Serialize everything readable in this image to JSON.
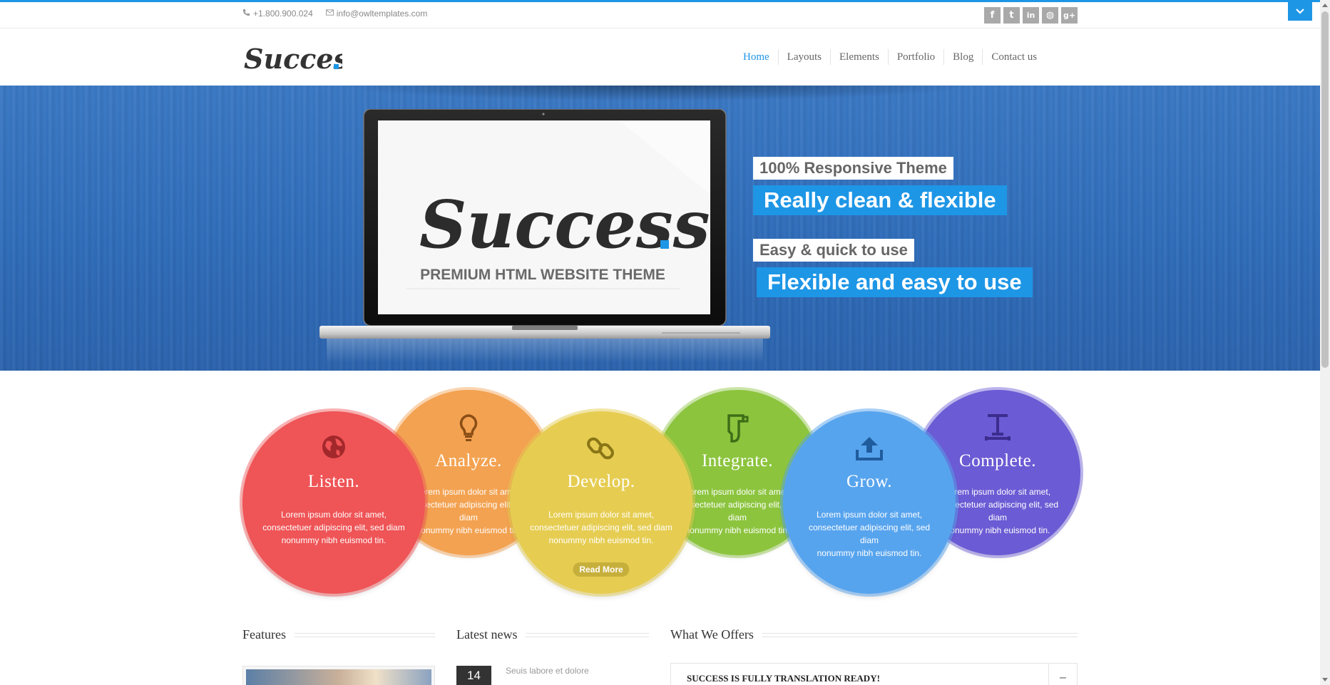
{
  "topbar": {
    "phone": "+1.800.900.024",
    "email": "info@owltemplates.com",
    "socials": [
      {
        "icon": "facebook-icon",
        "glyph": "f"
      },
      {
        "icon": "twitter-icon",
        "glyph": "t"
      },
      {
        "icon": "linkedin-icon",
        "glyph": "in"
      },
      {
        "icon": "dribbble-icon",
        "glyph": "◍"
      },
      {
        "icon": "googleplus-icon",
        "glyph": "g+"
      }
    ],
    "accent_color": "#1e96e6"
  },
  "header": {
    "logo_text": "Success",
    "nav": [
      {
        "label": "Home",
        "active": true
      },
      {
        "label": "Layouts",
        "active": false
      },
      {
        "label": "Elements",
        "active": false
      },
      {
        "label": "Portfolio",
        "active": false
      },
      {
        "label": "Blog",
        "active": false
      },
      {
        "label": "Contact us",
        "active": false
      }
    ]
  },
  "hero": {
    "screen_logo": "Success",
    "screen_tagline": "PREMIUM HTML WEBSITE THEME",
    "captions": [
      "100% Responsive Theme",
      "Really clean & flexible",
      "Easy & quick to use",
      "Flexible and easy to use"
    ]
  },
  "circles": [
    {
      "title": "Listen.",
      "icon": "globe-icon",
      "color": "#ef5456",
      "text": [
        "Lorem ipsum dolor sit amet,",
        "consectetuer adipiscing elit, sed diam",
        "nonummy nibh euismod tin."
      ]
    },
    {
      "title": "Analyze.",
      "icon": "lightbulb-icon",
      "color": "#f3a251",
      "text": [
        "Lorem ipsum dolor sit amet,",
        "consectetuer adipiscing elit, sed diam",
        "nonummy nibh euismod tin."
      ]
    },
    {
      "title": "Develop.",
      "icon": "link-icon",
      "color": "#e6cd52",
      "text": [
        "Lorem ipsum dolor sit amet,",
        "consectetuer adipiscing elit, sed diam",
        "nonummy nibh euismod tin."
      ],
      "button": "Read More"
    },
    {
      "title": "Integrate.",
      "icon": "hand-icon",
      "color": "#8cc43e",
      "text": [
        "Lorem ipsum dolor sit amet,",
        "consectetuer adipiscing elit, sed diam",
        "nonummy nibh euismod tin."
      ]
    },
    {
      "title": "Grow.",
      "icon": "upload-icon",
      "color": "#57a4ee",
      "text": [
        "Lorem ipsum dolor sit amet,",
        "consectetuer adipiscing elit, sed diam",
        "nonummy nibh euismod tin."
      ]
    },
    {
      "title": "Complete.",
      "icon": "text-icon",
      "color": "#6b5bd4",
      "text": [
        "Lorem ipsum dolor sit amet,",
        "consectetuer adipiscing elit, sed diam",
        "nonummy nibh euismod tin."
      ]
    }
  ],
  "sections": {
    "features_title": "Features",
    "news_title": "Latest news",
    "offers_title": "What We Offers",
    "news_item": {
      "day": "14",
      "title": "Seuis labore et dolore"
    },
    "offer_item": {
      "label": "SUCCESS IS FULLY TRANSLATION READY!",
      "toggle": "–"
    }
  }
}
